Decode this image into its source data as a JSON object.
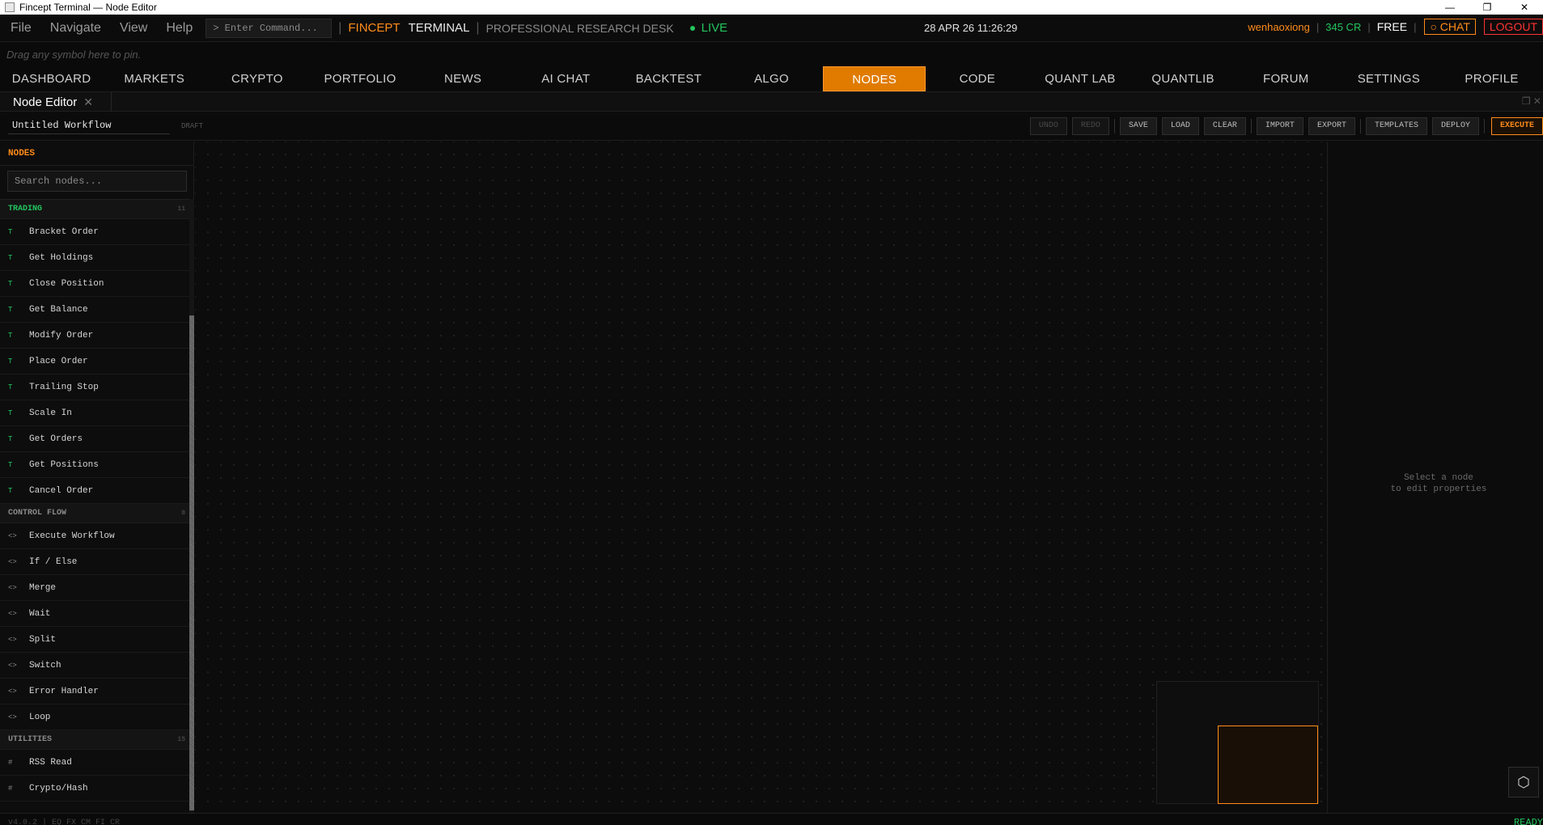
{
  "window": {
    "title": "Fincept Terminal — Node Editor",
    "controls": [
      "—",
      "❐",
      "✕"
    ]
  },
  "menubar": {
    "items": [
      "File",
      "Navigate",
      "View",
      "Help"
    ],
    "command_placeholder": "> Enter Command...",
    "brand_primary": "FINCEPT",
    "brand_secondary": "TERMINAL",
    "separator": "|",
    "desk_label": "PROFESSIONAL RESEARCH DESK",
    "live_label": "LIVE",
    "clock": "28 APR 26 11:26:29",
    "username": "wenhaoxiong",
    "credits": "345 CR",
    "plan": "FREE",
    "chat_label": "○ CHAT",
    "logout_label": "LOGOUT"
  },
  "drag_hint": "Drag any symbol here to pin.",
  "nav": {
    "tabs": [
      "DASHBOARD",
      "MARKETS",
      "CRYPTO",
      "PORTFOLIO",
      "NEWS",
      "AI CHAT",
      "BACKTEST",
      "ALGO",
      "NODES",
      "CODE",
      "QUANT LAB",
      "QUANTLIB",
      "FORUM",
      "SETTINGS",
      "PROFILE"
    ],
    "active": "NODES"
  },
  "panel": {
    "tab_title": "Node Editor",
    "close_glyph": "✕",
    "window_ctrls": "❐ ✕"
  },
  "workflow": {
    "name": "Untitled Workflow",
    "status": "DRAFT",
    "buttons": {
      "undo": "UNDO",
      "redo": "REDO",
      "save": "SAVE",
      "load": "LOAD",
      "clear": "CLEAR",
      "import": "IMPORT",
      "export": "EXPORT",
      "templates": "TEMPLATES",
      "deploy": "DEPLOY",
      "execute": "EXECUTE"
    }
  },
  "sidebar": {
    "title": "NODES",
    "search_placeholder": "Search nodes...",
    "categories": [
      {
        "name": "TRADING",
        "count": "11",
        "color": "#22c55e",
        "glyph": "T",
        "nodes": [
          "Bracket Order",
          "Get Holdings",
          "Close Position",
          "Get Balance",
          "Modify Order",
          "Place Order",
          "Trailing Stop",
          "Scale In",
          "Get Orders",
          "Get Positions",
          "Cancel Order"
        ]
      },
      {
        "name": "CONTROL FLOW",
        "count": "8",
        "color": "#8a8a8a",
        "glyph": "<>",
        "nodes": [
          "Execute Workflow",
          "If / Else",
          "Merge",
          "Wait",
          "Split",
          "Switch",
          "Error Handler",
          "Loop"
        ]
      },
      {
        "name": "UTILITIES",
        "count": "15",
        "color": "#8a8a8a",
        "glyph": "#",
        "nodes": [
          "RSS Read",
          "Crypto/Hash"
        ]
      }
    ]
  },
  "properties": {
    "empty_line1": "Select a node",
    "empty_line2": "to edit properties",
    "action_glyph": "⬡"
  },
  "footer": {
    "version": "v4.0.2 | EQ FX CM FI CR",
    "status": "READY"
  },
  "colors": {
    "accent": "#ff8c1a",
    "active_tab": "#e07b00",
    "live": "#22c55e",
    "danger": "#ff3333"
  }
}
